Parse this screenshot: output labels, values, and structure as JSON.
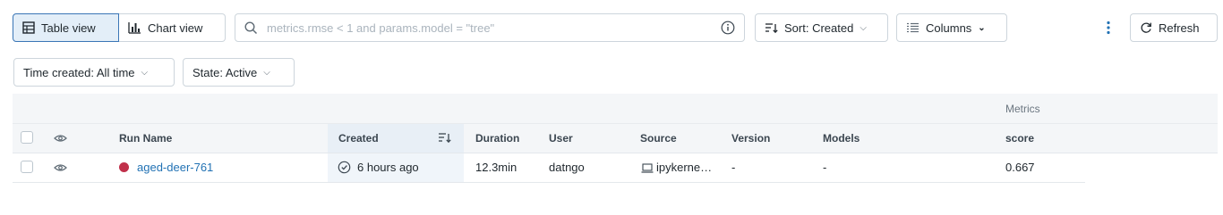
{
  "toolbar": {
    "table_view": "Table view",
    "chart_view": "Chart view",
    "search_placeholder": "metrics.rmse < 1 and params.model = \"tree\"",
    "sort_label": "Sort: Created",
    "columns_label": "Columns",
    "refresh_label": "Refresh"
  },
  "filters": {
    "time_created": "Time created: All time",
    "state": "State: Active"
  },
  "table": {
    "group_header": "Metrics",
    "columns": {
      "run_name": "Run Name",
      "created": "Created",
      "duration": "Duration",
      "user": "User",
      "source": "Source",
      "version": "Version",
      "models": "Models",
      "score": "score"
    },
    "rows": [
      {
        "run_name": "aged-deer-761",
        "run_color": "#c0304a",
        "created": "6 hours ago",
        "duration": "12.3min",
        "user": "datngo",
        "source": "ipykerne…",
        "version": "-",
        "models": "-",
        "score": "0.667"
      }
    ]
  },
  "colors": {
    "accent": "#2272b4",
    "selected_bg": "#e3eef8"
  }
}
